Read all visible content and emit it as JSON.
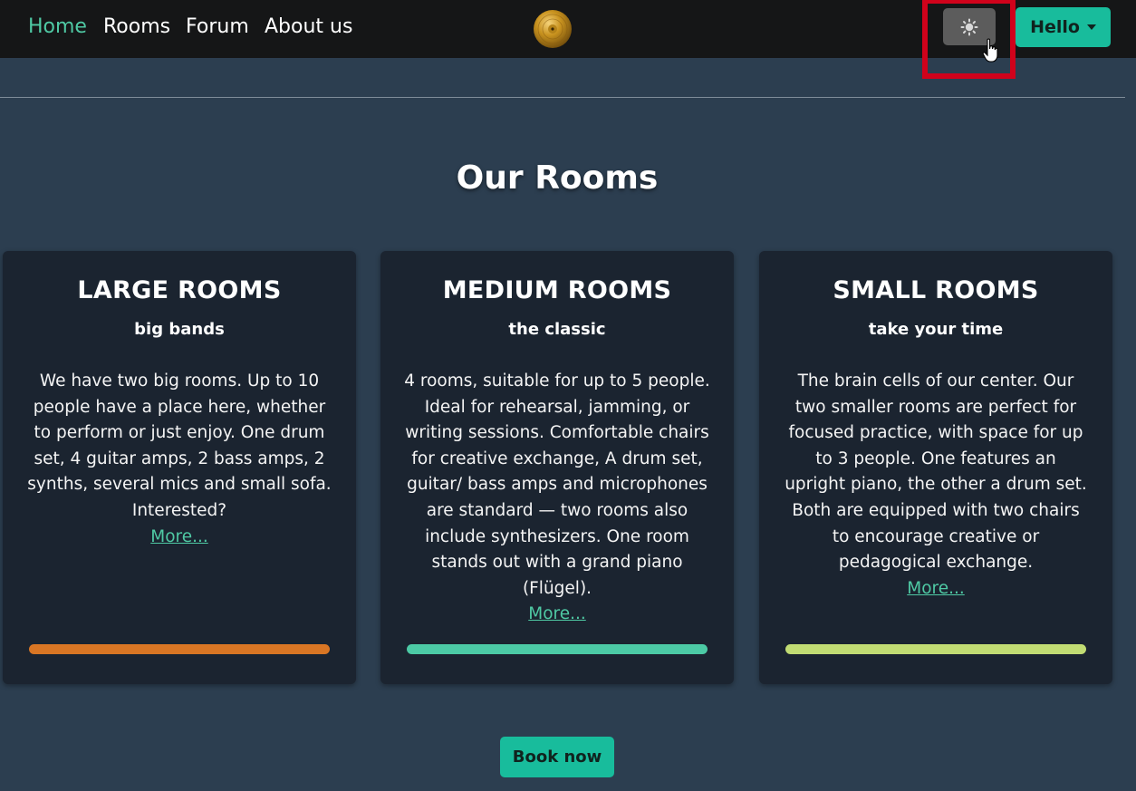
{
  "nav": {
    "links": [
      {
        "label": "Home",
        "active": true
      },
      {
        "label": "Rooms",
        "active": false
      },
      {
        "label": "Forum",
        "active": false
      },
      {
        "label": "About us",
        "active": false
      }
    ],
    "logo_icon": "vinyl-record-icon",
    "theme_toggle_icon": "sun-icon",
    "user_menu_label": "Hello"
  },
  "page": {
    "title": "Our Rooms",
    "book_button_label": "Book now"
  },
  "cards": [
    {
      "title": "LARGE ROOMS",
      "subtitle": "big bands",
      "text": "We have two big rooms. Up to 10 people have a place here, whether to perform or just enjoy. One drum set, 4 guitar amps, 2 bass amps, 2 synths, several mics and small sofa. Interested?",
      "link": "More...",
      "accent_color": "#d97624"
    },
    {
      "title": "MEDIUM ROOMS",
      "subtitle": "the classic",
      "text": "4 rooms, suitable for up to 5 people. Ideal for rehearsal, jamming, or writing sessions. Comfortable chairs for creative exchange, A drum set, guitar/ bass amps and microphones are standard — two rooms also include synthesizers. One room stands out with a grand piano (Flügel).",
      "link": "More...",
      "accent_color": "#4ccaa5"
    },
    {
      "title": "SMALL ROOMS",
      "subtitle": "take your time",
      "text": "The brain cells of our center. Our two smaller rooms are perfect for focused practice, with space for up to 3 people. One features an upright piano, the other a drum set. Both are equipped with two chairs to encourage creative or pedagogical exchange.",
      "link": "More...",
      "accent_color": "#c1dc73"
    }
  ],
  "colors": {
    "background": "#2c3e50",
    "navbar": "#151617",
    "primary": "#18bc9c",
    "highlight": "#d0021b"
  }
}
